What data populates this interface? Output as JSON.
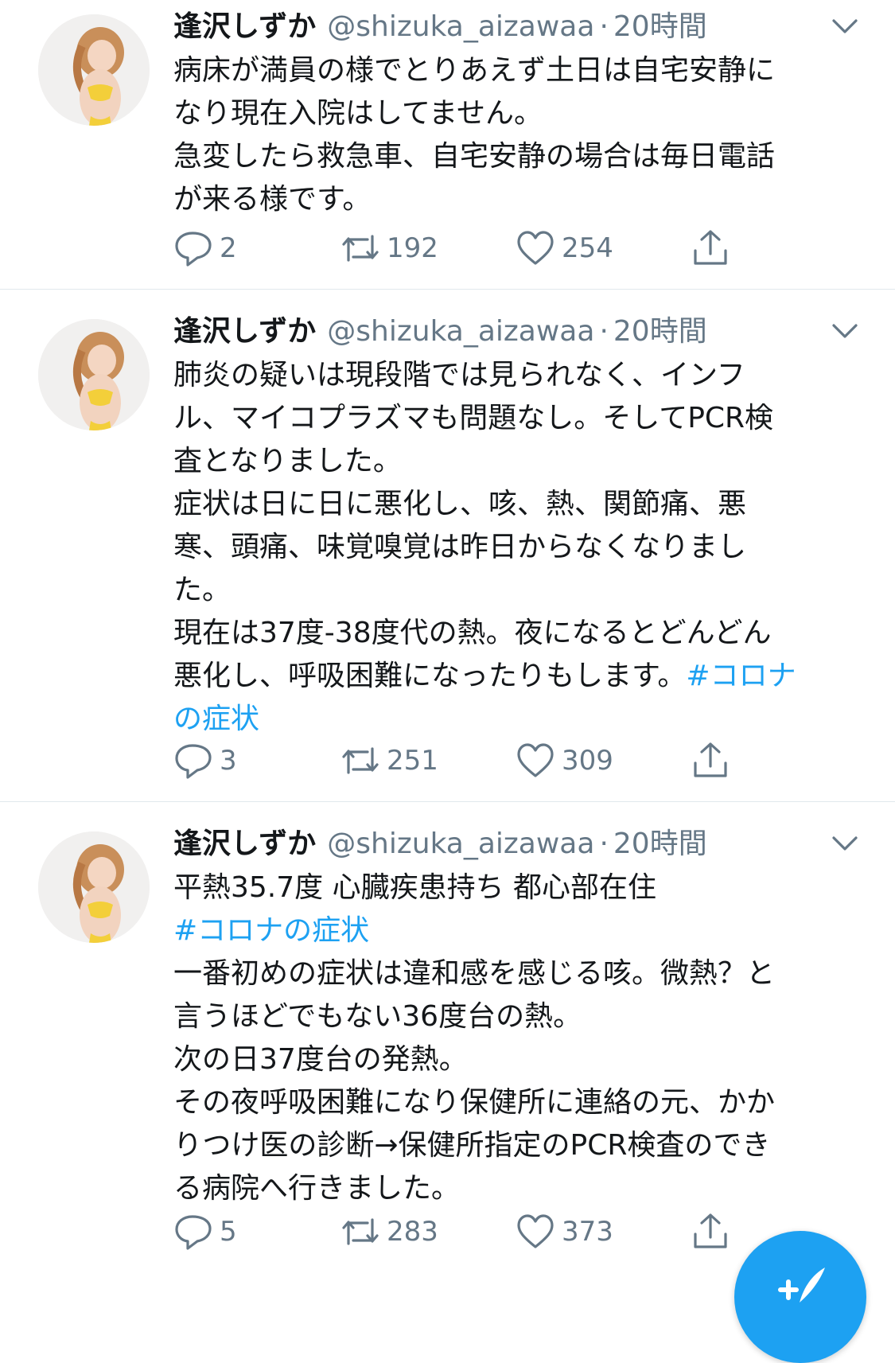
{
  "colors": {
    "accent": "#1da1f2",
    "muted": "#657786",
    "text": "#14171a",
    "divider": "#e1e8ed"
  },
  "tweets": [
    {
      "name": "逢沢しずか",
      "handle": "@shizuka_aizawaa",
      "separator": "·",
      "time": "20時間",
      "lines": [
        [
          {
            "t": "病床が満員の様でとりあえず土日は自宅安静に"
          }
        ],
        [
          {
            "t": "なり現在入院はしてません。"
          }
        ],
        [
          {
            "t": "急変したら救急車、自宅安静の場合は毎日電話"
          }
        ],
        [
          {
            "t": "が来る様です。"
          }
        ]
      ],
      "replies": "2",
      "retweets": "192",
      "likes": "254"
    },
    {
      "name": "逢沢しずか",
      "handle": "@shizuka_aizawaa",
      "separator": "·",
      "time": "20時間",
      "lines": [
        [
          {
            "t": "肺炎の疑いは現段階では見られなく、インフ"
          }
        ],
        [
          {
            "t": "ル、マイコプラズマも問題なし。そしてPCR検"
          }
        ],
        [
          {
            "t": "査となりました。"
          }
        ],
        [
          {
            "t": "症状は日に日に悪化し、咳、熱、関節痛、悪"
          }
        ],
        [
          {
            "t": "寒、頭痛、味覚嗅覚は昨日からなくなりまし"
          }
        ],
        [
          {
            "t": "た。"
          }
        ],
        [
          {
            "t": "現在は37度-38度代の熱。夜になるとどんどん"
          }
        ],
        [
          {
            "t": "悪化し、呼吸困難になったりもします。"
          },
          {
            "t": "#コロナ",
            "tag": true
          }
        ],
        [
          {
            "t": "の症状",
            "tag": true
          }
        ]
      ],
      "replies": "3",
      "retweets": "251",
      "likes": "309"
    },
    {
      "name": "逢沢しずか",
      "handle": "@shizuka_aizawaa",
      "separator": "·",
      "time": "20時間",
      "lines": [
        [
          {
            "t": "平熱35.7度 心臓疾患持ち 都心部在住"
          }
        ],
        [
          {
            "t": "#コロナの症状",
            "tag": true
          }
        ],
        [
          {
            "t": "一番初めの症状は違和感を感じる咳。微熱？と"
          }
        ],
        [
          {
            "t": "言うほどでもない36度台の熱。"
          }
        ],
        [
          {
            "t": "次の日37度台の発熱。"
          }
        ],
        [
          {
            "t": "その夜呼吸困難になり保健所に連絡の元、かか"
          }
        ],
        [
          {
            "t": "りつけ医の診断→保健所指定のPCR検査のでき"
          }
        ],
        [
          {
            "t": "る病院へ行きました。"
          }
        ]
      ],
      "replies": "5",
      "retweets": "283",
      "likes": "373"
    }
  ]
}
